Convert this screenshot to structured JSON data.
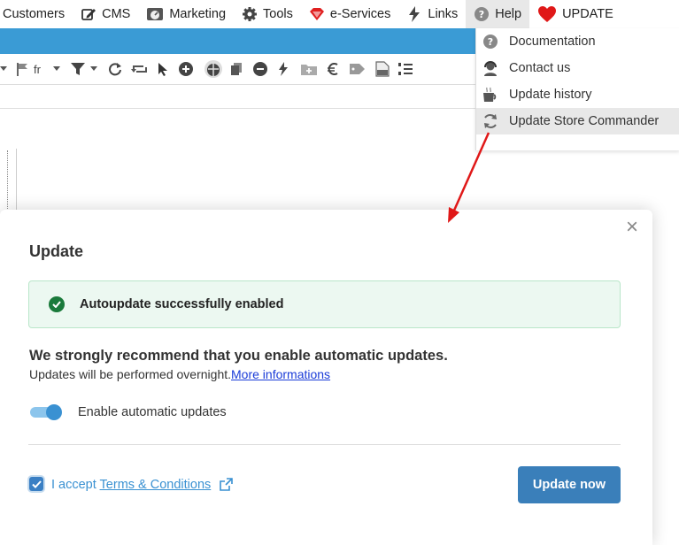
{
  "menubar": {
    "items": [
      {
        "label": "Customers",
        "icon": null
      },
      {
        "label": "CMS",
        "icon": "pencil-square-icon"
      },
      {
        "label": "Marketing",
        "icon": "dashboard-icon"
      },
      {
        "label": "Tools",
        "icon": "gear-icon"
      },
      {
        "label": "e-Services",
        "icon": "diamond-icon"
      },
      {
        "label": "Links",
        "icon": "bolt-icon"
      },
      {
        "label": "Help",
        "icon": "question-circle-icon"
      },
      {
        "label": "UPDATE",
        "icon": "heart-icon"
      }
    ],
    "accent_color": "#3a9bd5"
  },
  "toolbar": {
    "lang_label": "fr"
  },
  "help_menu": {
    "items": [
      {
        "label": "Documentation",
        "icon": "question-circle-icon"
      },
      {
        "label": "Contact us",
        "icon": "headset-icon"
      },
      {
        "label": "Update history",
        "icon": "coffee-icon"
      },
      {
        "label": "Update Store Commander",
        "icon": "refresh-icon"
      }
    ]
  },
  "modal": {
    "title": "Update",
    "close_label": "×",
    "alert_message": "Autoupdate successfully enabled",
    "recommend_text": "We strongly recommend that you enable automatic updates.",
    "sub_text": "Updates will be performed overnight.",
    "more_link": "More informations",
    "toggle_label": "Enable automatic updates",
    "toggle_on": true,
    "accept_prefix": "I accept ",
    "terms_link": "Terms & Conditions",
    "accept_checked": true,
    "update_button": "Update now",
    "success_color": "#1a7a3b",
    "button_color": "#3a7fba"
  }
}
